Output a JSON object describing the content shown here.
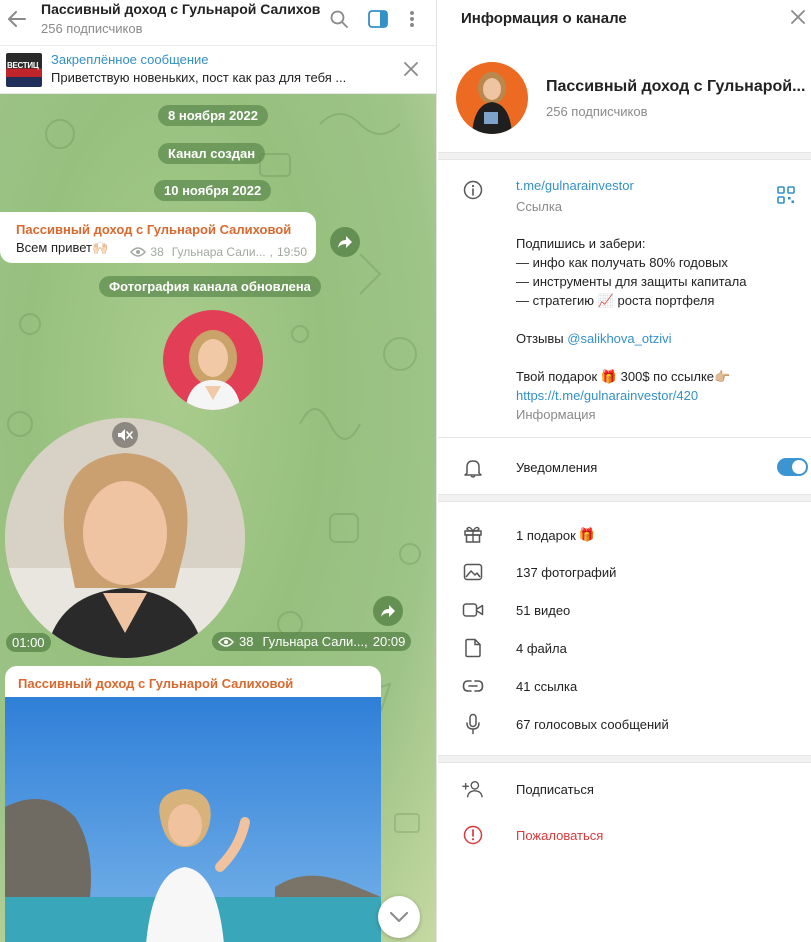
{
  "chat": {
    "title": "Пассивный доход с Гульнарой Салихов...",
    "subscribers": "256 подписчиков",
    "pinned": {
      "title": "Закреплённое сообщение",
      "text": "Приветствую новеньких, пост как раз для тебя ..."
    },
    "service": {
      "date1": "8 ноября 2022",
      "created": "Канал создан",
      "date2": "10 ноября 2022",
      "photo_updated": "Фотография канала обновлена"
    },
    "msg1": {
      "author": "Пассивный доход с Гульнарой Салиховой",
      "text": "Всем привет🙌🏻",
      "views": "38",
      "signature": "Гульнара Сали...",
      "time": "19:50"
    },
    "video": {
      "duration": "01:00",
      "views": "38",
      "signature": "Гульнара Сали...",
      "time": "20:09"
    },
    "msg3": {
      "author": "Пассивный доход с Гульнарой Салиховой"
    }
  },
  "info": {
    "title": "Информация о канале",
    "name": "Пассивный доход с Гульнарой...",
    "subscribers": "256 подписчиков",
    "link": "t.me/gulnarainvestor",
    "link_caption": "Ссылка",
    "desc": {
      "l1": "Подпишись и забери:",
      "l2": "— инфо как получать 80% годовых",
      "l3": "— инструменты для защиты капитала",
      "l4a": "— стратегию",
      "l4emoji": "📈",
      "l4b": "роста портфеля",
      "l5a": "Отзывы",
      "l5link": "@salikhova_otzivi",
      "l6a": "Твой подарок",
      "l6emoji": "🎁",
      "l6b": "300$ по ссылке👉🏼",
      "l7link": "https://t.me/gulnarainvestor/420",
      "caption": "Информация"
    },
    "notifications": "Уведомления",
    "notifications_on": true,
    "media": {
      "gifts": "1 подарок",
      "gifts_emoji": "🎁",
      "photos": "137 фотографий",
      "videos": "51 видео",
      "files": "4 файла",
      "links": "41 ссылка",
      "voice": "67 голосовых сообщений"
    },
    "subscribe": "Подписаться",
    "report": "Пожаловаться"
  },
  "colors": {
    "accent": "#3390c7",
    "author": "#d9692f",
    "danger": "#d83a3a",
    "toggle": "#3c95d1"
  },
  "pinned_thumb_text": "ВЕСТИЦ"
}
